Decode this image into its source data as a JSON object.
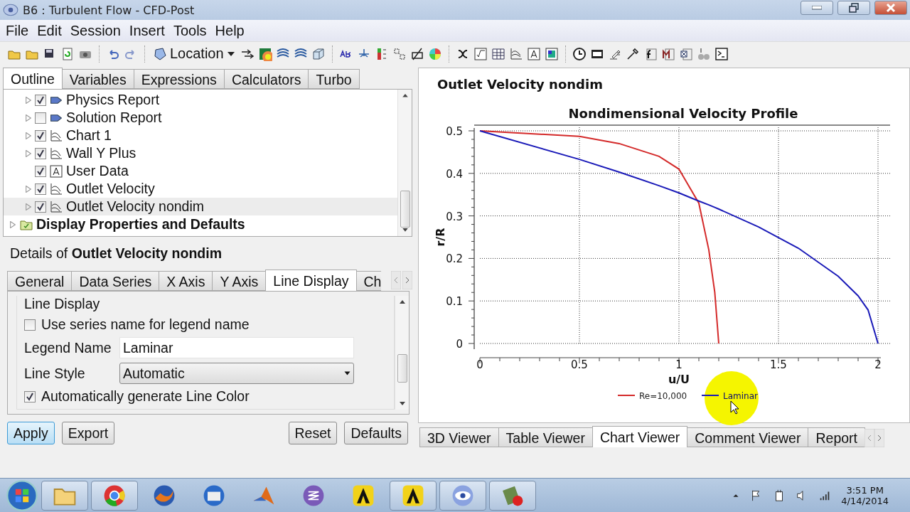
{
  "window": {
    "title": "B6 : Turbulent Flow - CFD-Post"
  },
  "menu": [
    "File",
    "Edit",
    "Session",
    "Insert",
    "Tools",
    "Help"
  ],
  "toolbar": {
    "location_button": "Location"
  },
  "outline_tabs": [
    {
      "label": "Outline",
      "selected": true
    },
    {
      "label": "Variables",
      "selected": false
    },
    {
      "label": "Expressions",
      "selected": false
    },
    {
      "label": "Calculators",
      "selected": false
    },
    {
      "label": "Turbo",
      "selected": false
    }
  ],
  "tree": {
    "items": [
      {
        "children": [
          {
            "label": "Physics Report",
            "kind": "report",
            "expandable": true,
            "checked": true,
            "selected": false
          },
          {
            "label": "Solution Report",
            "kind": "report",
            "expandable": true,
            "checked": false,
            "selected": false
          },
          {
            "label": "Chart 1",
            "kind": "chart",
            "expandable": true,
            "checked": true,
            "selected": false
          },
          {
            "label": "Wall Y Plus",
            "kind": "chart",
            "expandable": true,
            "checked": true,
            "selected": false
          },
          {
            "label": "User Data",
            "kind": "text",
            "expandable": false,
            "checked": true,
            "selected": false
          },
          {
            "label": "Outlet Velocity",
            "kind": "chart",
            "expandable": true,
            "checked": true,
            "selected": false
          },
          {
            "label": "Outlet Velocity nondim",
            "kind": "chart",
            "expandable": true,
            "checked": true,
            "selected": true
          }
        ]
      },
      {
        "label": "Display Properties and Defaults",
        "kind": "folder",
        "expandable": true,
        "selected": false
      }
    ]
  },
  "details": {
    "heading": "Details of **Outlet Velocity nondim**",
    "tabs": [
      {
        "label": "General",
        "selected": false
      },
      {
        "label": "Data Series",
        "selected": false
      },
      {
        "label": "X Axis",
        "selected": false
      },
      {
        "label": "Y Axis",
        "selected": false
      },
      {
        "label": "Line Display",
        "selected": true
      },
      {
        "label": "Ch",
        "selected": false
      }
    ],
    "group_title": "Line Display",
    "use_series_name": {
      "label": "Use series name for legend name",
      "checked": false
    },
    "legend_name": {
      "label": "Legend Name",
      "value": "Laminar"
    },
    "line_style": {
      "label": "Line Style",
      "value": "Automatic"
    },
    "auto_color": {
      "label": "Automatically generate Line Color",
      "checked": true
    },
    "buttons_left": [
      {
        "label": "Apply",
        "default": true
      },
      {
        "label": "Export",
        "default": false
      }
    ],
    "buttons_right": [
      {
        "label": "Reset",
        "default": false
      },
      {
        "label": "Defaults",
        "default": false
      }
    ]
  },
  "chart_panel": {
    "title": "Outlet Velocity nondim",
    "chart_data": {
      "type": "line",
      "title": "Nondimensional Velocity Profile",
      "xlabel": "u/U",
      "ylabel": "r/R",
      "x": [
        0,
        0.5,
        0.7,
        0.9,
        1.0,
        1.1,
        1.15,
        1.18,
        1.2,
        1.4,
        1.6,
        1.8,
        1.9,
        1.95,
        2.0
      ],
      "series": [
        {
          "name": "Re=10,000",
          "color": "#d42a2a",
          "values": [
            0.5,
            0.487,
            0.47,
            0.44,
            0.41,
            0.33,
            0.22,
            0.12,
            0,
            null,
            null,
            null,
            null,
            null,
            null
          ]
        },
        {
          "name": "Laminar",
          "color": "#1a1ab8",
          "values": [
            0.5,
            0.433,
            0.403,
            0.371,
            0.354,
            0.335,
            0.326,
            0.32,
            0.316,
            0.274,
            0.224,
            0.158,
            0.112,
            0.079,
            0
          ]
        }
      ],
      "grid": true,
      "legend": true,
      "xlim": [
        0,
        2
      ],
      "ylim": [
        0,
        0.5
      ],
      "xticks": [
        0,
        0.5,
        1,
        1.5,
        2
      ],
      "yticks": [
        0,
        0.1,
        0.2,
        0.3,
        0.4,
        0.5
      ]
    }
  },
  "viewer_tabs": [
    {
      "label": "3D Viewer",
      "selected": false
    },
    {
      "label": "Table Viewer",
      "selected": false
    },
    {
      "label": "Chart Viewer",
      "selected": true
    },
    {
      "label": "Comment Viewer",
      "selected": false
    },
    {
      "label": "Report",
      "selected": false
    }
  ],
  "taskbar": {
    "apps": [
      {
        "kind": "folder",
        "active": true
      },
      {
        "kind": "browser",
        "active": true
      },
      {
        "kind": "fox",
        "active": false
      },
      {
        "kind": "mail",
        "active": false
      },
      {
        "kind": "peak",
        "active": false
      },
      {
        "kind": "swirl",
        "active": false
      },
      {
        "kind": "letter",
        "active": false
      },
      {
        "kind": "letter",
        "active": true
      },
      {
        "kind": "eye",
        "active": true
      },
      {
        "kind": "tool",
        "active": true
      }
    ],
    "time": "3:51 PM",
    "date": "4/14/2014"
  }
}
